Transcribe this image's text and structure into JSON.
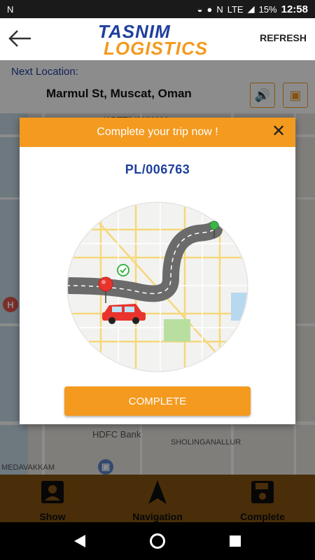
{
  "status_bar": {
    "carrier_icon": "N",
    "lte": "LTE",
    "battery": "15%",
    "time": "12:58"
  },
  "header": {
    "logo_line1": "TASNIM",
    "logo_line2": "LOGISTICS",
    "refresh_label": "REFRESH"
  },
  "next_location": {
    "label": "Next Location:",
    "address": "Marmul St, Muscat, Oman"
  },
  "map": {
    "labels": [
      "KOTTIVAKKAM",
      "HDFC Bank",
      "SHOLINGANALLUR",
      "MEDAVAKKAM"
    ]
  },
  "dialog": {
    "title": "Complete your trip now !",
    "trip_id": "PL/006763",
    "complete_label": "COMPLETE"
  },
  "bottom_nav": [
    {
      "label": "Show",
      "icon": "person-icon"
    },
    {
      "label": "Navigation",
      "icon": "navigation-arrow-icon"
    },
    {
      "label": "Complete",
      "icon": "floppy-save-icon"
    }
  ],
  "colors": {
    "accent": "#f39a1f",
    "brand_blue": "#1f3f9c"
  }
}
